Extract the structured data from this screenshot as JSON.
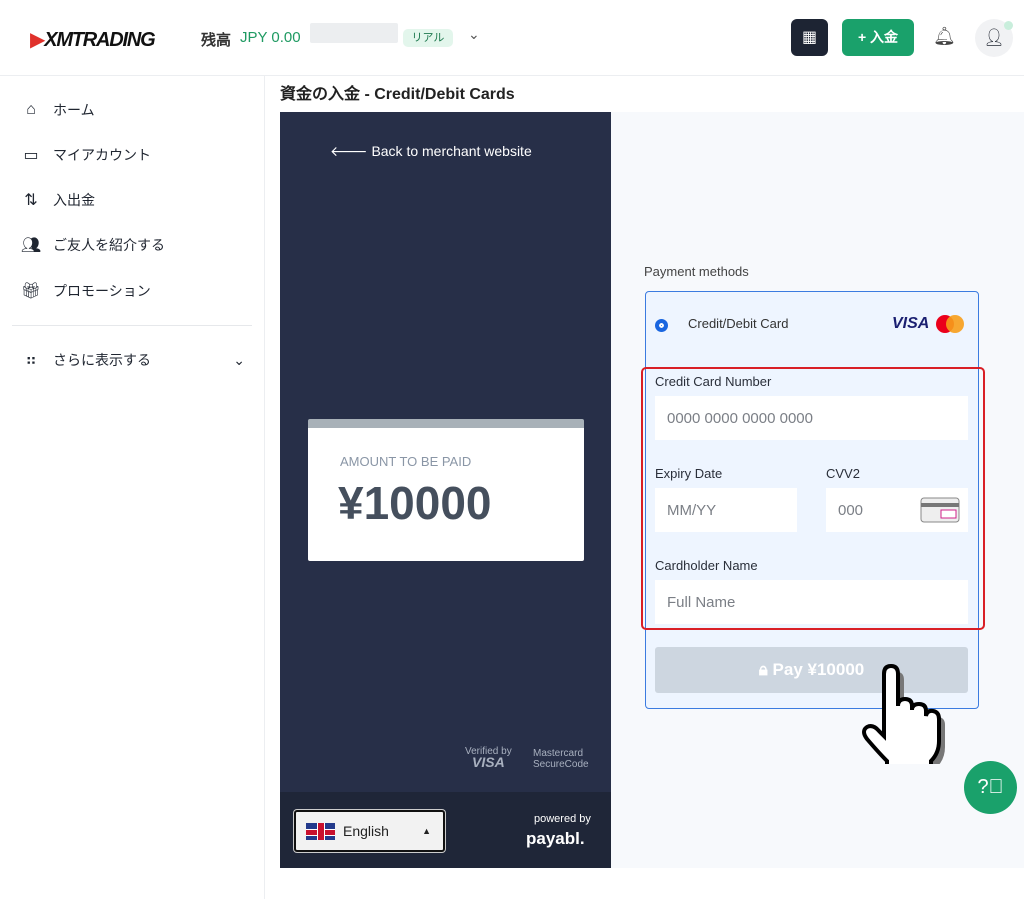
{
  "header": {
    "logo": "XMTRADING",
    "balance_label": "残高",
    "balance_value": "JPY 0.00",
    "account_type": "リアル",
    "deposit_label": "+ 入金",
    "colors": {
      "brand_green": "#1aa16b"
    }
  },
  "sidebar": {
    "items": [
      {
        "label": "ホーム",
        "icon": "home-icon"
      },
      {
        "label": "マイアカウント",
        "icon": "card-icon"
      },
      {
        "label": "入出金",
        "icon": "transfer-icon"
      },
      {
        "label": "ご友人を紹介する",
        "icon": "users-icon"
      },
      {
        "label": "プロモーション",
        "icon": "gift-icon"
      }
    ],
    "more_label": "さらに表示する"
  },
  "page": {
    "title": "資金の入金 - Credit/Debit Cards"
  },
  "merchant": {
    "back_label": "Back to merchant website",
    "amount_label": "AMOUNT TO BE PAID",
    "amount": "¥10000",
    "verified_by": "Verified by",
    "visa": "VISA",
    "mastercard_line1": "Mastercard",
    "mastercard_line2": "SecureCode",
    "language": "English",
    "powered_by": "powered by",
    "powered_brand": "payabl."
  },
  "payment": {
    "methods_label": "Payment methods",
    "method": "Credit/Debit Card",
    "visa_logo": "VISA",
    "card_number_label": "Credit Card Number",
    "card_number_placeholder": "0000 0000 0000 0000",
    "expiry_label": "Expiry Date",
    "expiry_placeholder": "MM/YY",
    "cvv_label": "CVV2",
    "cvv_placeholder": "000",
    "name_label": "Cardholder Name",
    "name_placeholder": "Full Name",
    "pay_label": "Pay ¥10000"
  }
}
